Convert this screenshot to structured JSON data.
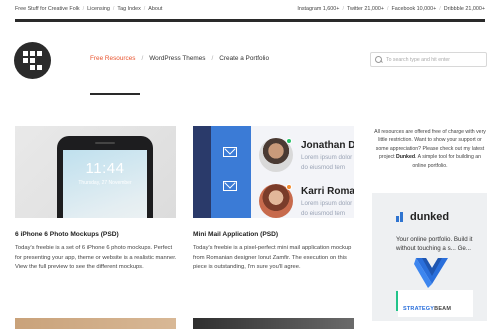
{
  "topbar": {
    "links": [
      "Free Stuff for Creative Folk",
      "Licensing",
      "Tag Index",
      "About"
    ],
    "social": [
      "Instagram 1,600+",
      "Twitter 21,000+",
      "Facebook 10,000+",
      "Dribbble 21,000+"
    ]
  },
  "nav": {
    "items": [
      "Free Resources",
      "WordPress Themes",
      "Create a Portfolio"
    ],
    "active_color": "#e8542f"
  },
  "search": {
    "placeholder": "To search type and hit enter"
  },
  "cards": [
    {
      "title": "6 iPhone 6 Photo Mockups (PSD)",
      "desc": "Today's freebie is a set of 6 iPhone 6 photo mockups. Perfect for presenting your app, theme or website is a realistic manner. View the full preview to see the different mockups.",
      "phone_time": "11:44",
      "phone_date": "Thursday, 27 November"
    },
    {
      "title": "Mini Mail Application (PSD)",
      "desc": "Today's freebie is a pixel-perfect mini mail application mockup from Romanian designer Ionut Zamfir. The execution on this piece is outstanding, I'm sure you'll agree.",
      "mail_rows": [
        {
          "name": "Jonathan D",
          "lines": [
            "Lorem ipsum dolor",
            "do eiusmod tem"
          ]
        },
        {
          "name": "Karri Roma",
          "lines": [
            "Lorem ipsum dolor",
            "do eiusmod tem"
          ]
        }
      ]
    }
  ],
  "sidebar": {
    "intro_before": "All resources are offered free of charge with very little restriction. Want to show your support or some appreciation? Please check out my latest project ",
    "intro_link": "Dunked",
    "intro_after": ". A simple tool for building an online portfolio.",
    "ad": {
      "brand": "dunked",
      "copy": "Your online portfolio. Build it without touching a s... Ge...",
      "badge_text_a": "STRATEGY",
      "badge_text_b": "BEAM"
    }
  },
  "colors": {
    "accent": "#e8542f",
    "dunked_blue": "#2f74d0",
    "dark": "#2a2a2a"
  }
}
